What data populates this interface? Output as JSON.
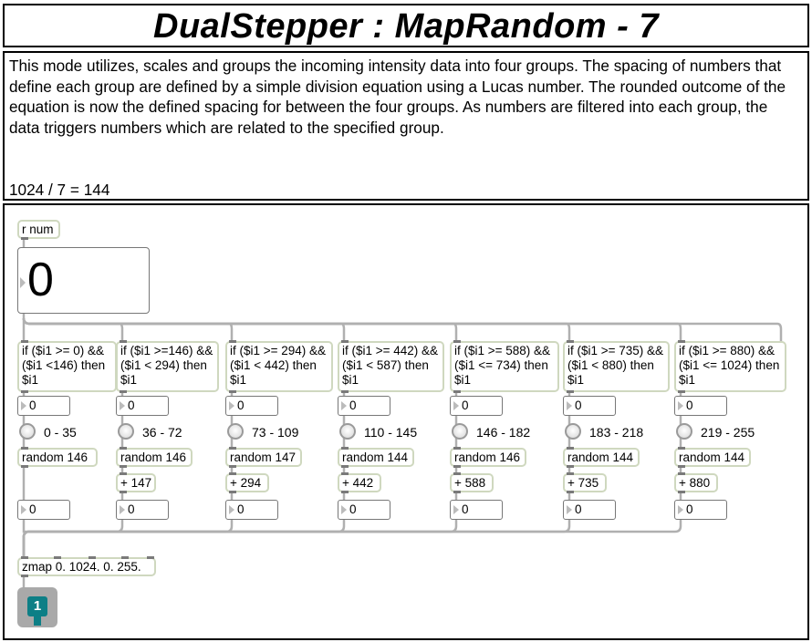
{
  "title": "DualStepper : MapRandom - 7",
  "description": "This mode utilizes, scales and groups the incoming intensity data into four groups. The spacing of numbers that define each group are defined by a simple division equation using a Lucas number. The rounded outcome of the equation is now the defined spacing for between the four groups. As numbers are filtered into each group, the data triggers numbers which are related to the specified group.",
  "equation": "1024 / 7 = 144",
  "patch": {
    "receive": "r num",
    "input_value": "0",
    "zmap": "zmap 0. 1024. 0. 255.",
    "preset_label": "1",
    "columns": [
      {
        "expr": "if ($i1 >= 0) && ($i1 <146) then $i1",
        "in_value": "0",
        "range": "0 - 35",
        "random": "random 146",
        "add": "",
        "out_value": "0"
      },
      {
        "expr": "if ($i1 >=146) && ($i1 < 294) then $i1",
        "in_value": "0",
        "range": "36 - 72",
        "random": "random 146",
        "add": "+ 147",
        "out_value": "0"
      },
      {
        "expr": "if ($i1 >= 294) && ($i1 < 442) then $i1",
        "in_value": "0",
        "range": "73 - 109",
        "random": "random 147",
        "add": "+ 294",
        "out_value": "0"
      },
      {
        "expr": "if ($i1 >= 442) && ($i1 < 587) then $i1",
        "in_value": "0",
        "range": "110 - 145",
        "random": "random 144",
        "add": "+ 442",
        "out_value": "0"
      },
      {
        "expr": "if ($i1 >= 588) && ($i1 <= 734) then $i1",
        "in_value": "0",
        "range": "146 - 182",
        "random": "random 146",
        "add": "+ 588",
        "out_value": "0"
      },
      {
        "expr": "if ($i1 >= 735) && ($i1 < 880) then $i1",
        "in_value": "0",
        "range": "183 - 218",
        "random": "random 144",
        "add": "+ 735",
        "out_value": "0"
      },
      {
        "expr": "if ($i1 >= 880) && ($i1 <= 1024) then $i1",
        "in_value": "0",
        "range": "219 - 255",
        "random": "random 144",
        "add": "+ 880",
        "out_value": "0"
      }
    ]
  },
  "colors": {
    "object_border": "#cfd8bf",
    "cord": "#b0b0b0",
    "preset_teal": "#0d7f86"
  }
}
